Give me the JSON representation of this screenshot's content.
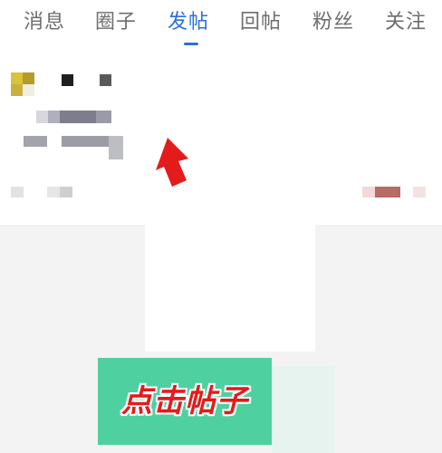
{
  "tabs": [
    {
      "label": "消息",
      "active": false
    },
    {
      "label": "圈子",
      "active": false
    },
    {
      "label": "发帖",
      "active": true
    },
    {
      "label": "回帖",
      "active": false
    },
    {
      "label": "粉丝",
      "active": false
    },
    {
      "label": "关注",
      "active": false
    }
  ],
  "callout": {
    "text": "点击帖子"
  },
  "colors": {
    "active_tab": "#2f6fd1",
    "inactive_tab": "#6e6e6e",
    "arrow": "#e41b1b",
    "callout_bg": "#4fd0a0",
    "callout_text": "#e41b1b",
    "lower_bg": "#f3f3f3"
  },
  "icons": {
    "pointer": "red-arrow-icon",
    "avatar": "avatar-icon"
  }
}
